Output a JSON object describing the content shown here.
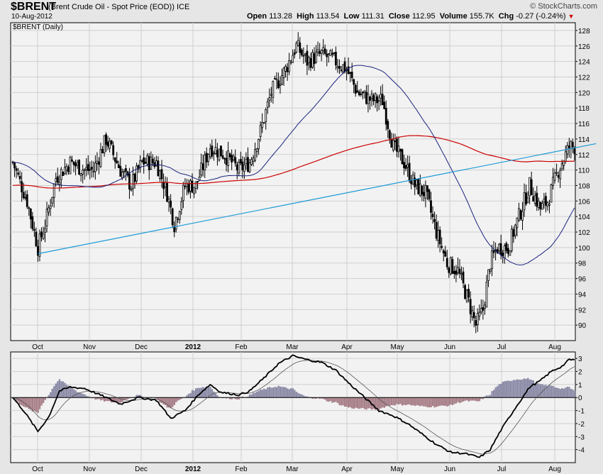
{
  "header": {
    "symbol": "$BRENT",
    "description": "(Brent Crude Oil - Spot Price (EOD))",
    "exchange": "ICE",
    "date": "10-Aug-2012",
    "logo": "© StockCharts.com",
    "open_label": "Open",
    "open": "113.28",
    "high_label": "High",
    "high": "113.54",
    "low_label": "Low",
    "low": "111.31",
    "close_label": "Close",
    "close": "112.95",
    "volume_label": "Volume",
    "volume": "155.7K",
    "chg_label": "Chg",
    "chg": "-0.27 (-0.24%)",
    "chg_icon": "down-triangle-icon"
  },
  "chart_data": [
    {
      "type": "candlestick",
      "legend_label": "$BRENT (Daily)",
      "ylim": [
        88,
        129
      ],
      "y_ticks": [
        90,
        92,
        94,
        96,
        98,
        100,
        102,
        104,
        106,
        108,
        110,
        112,
        114,
        116,
        118,
        120,
        122,
        124,
        126,
        128
      ],
      "x_ticks": [
        "Oct",
        "Nov",
        "Dec",
        "2012",
        "Feb",
        "Mar",
        "Apr",
        "May",
        "Jun",
        "Jul",
        "Aug"
      ],
      "grid": true,
      "price_keypoints": [
        [
          0,
          111
        ],
        [
          8,
          106
        ],
        [
          14,
          100
        ],
        [
          18,
          103
        ],
        [
          24,
          109
        ],
        [
          32,
          111
        ],
        [
          40,
          110
        ],
        [
          45,
          110
        ],
        [
          52,
          114
        ],
        [
          60,
          110
        ],
        [
          66,
          108
        ],
        [
          72,
          111
        ],
        [
          80,
          111
        ],
        [
          86,
          107
        ],
        [
          90,
          103
        ],
        [
          96,
          108
        ],
        [
          102,
          108
        ],
        [
          110,
          113
        ],
        [
          118,
          112
        ],
        [
          126,
          110
        ],
        [
          132,
          111
        ],
        [
          138,
          115
        ],
        [
          144,
          120
        ],
        [
          152,
          123
        ],
        [
          158,
          126
        ],
        [
          164,
          124
        ],
        [
          172,
          125
        ],
        [
          180,
          124
        ],
        [
          186,
          123
        ],
        [
          192,
          120
        ],
        [
          200,
          119
        ],
        [
          206,
          119
        ],
        [
          212,
          113
        ],
        [
          218,
          111
        ],
        [
          224,
          108
        ],
        [
          230,
          107
        ],
        [
          236,
          102
        ],
        [
          242,
          98
        ],
        [
          248,
          97
        ],
        [
          254,
          93
        ],
        [
          258,
          90
        ],
        [
          262,
          92
        ],
        [
          266,
          98
        ],
        [
          270,
          100
        ],
        [
          276,
          100
        ],
        [
          282,
          104
        ],
        [
          288,
          108
        ],
        [
          294,
          105
        ],
        [
          298,
          106
        ],
        [
          304,
          110
        ],
        [
          308,
          112
        ],
        [
          310,
          113
        ]
      ],
      "overlays": [
        {
          "name": "ma50",
          "color": "#1a237e"
        },
        {
          "name": "ma200",
          "color": "#cc0000"
        },
        {
          "name": "trendline",
          "color": "#1a9ad6",
          "from": [
            14,
            99.2
          ],
          "to": [
            325,
            113.4
          ]
        }
      ]
    },
    {
      "type": "oscillator",
      "ylim": [
        -5,
        3.5
      ],
      "y_ticks": [
        -4,
        -3,
        -2,
        -1,
        0,
        1,
        2,
        3
      ],
      "x_ticks": [
        "Oct",
        "Nov",
        "Dec",
        "2012",
        "Feb",
        "Mar",
        "Apr",
        "May",
        "Jun",
        "Jul",
        "Aug"
      ],
      "grid": true,
      "macd_keypoints": [
        [
          0,
          0
        ],
        [
          6,
          -1
        ],
        [
          14,
          -2.6
        ],
        [
          20,
          -1.5
        ],
        [
          26,
          0.5
        ],
        [
          32,
          0.8
        ],
        [
          40,
          0.7
        ],
        [
          52,
          0
        ],
        [
          60,
          -0.5
        ],
        [
          70,
          0
        ],
        [
          80,
          -0.2
        ],
        [
          88,
          -1.6
        ],
        [
          96,
          -1
        ],
        [
          104,
          0.3
        ],
        [
          110,
          1
        ],
        [
          116,
          0.4
        ],
        [
          126,
          0.2
        ],
        [
          132,
          0.5
        ],
        [
          140,
          1.5
        ],
        [
          148,
          2.6
        ],
        [
          156,
          3.2
        ],
        [
          164,
          2.9
        ],
        [
          172,
          2.7
        ],
        [
          180,
          2.1
        ],
        [
          188,
          1
        ],
        [
          196,
          0
        ],
        [
          204,
          -1
        ],
        [
          212,
          -1.4
        ],
        [
          220,
          -2
        ],
        [
          228,
          -2.8
        ],
        [
          236,
          -3.6
        ],
        [
          244,
          -4.2
        ],
        [
          252,
          -4.3
        ],
        [
          260,
          -4.6
        ],
        [
          266,
          -4
        ],
        [
          272,
          -2.5
        ],
        [
          280,
          -0.8
        ],
        [
          288,
          0.8
        ],
        [
          294,
          1.3
        ],
        [
          300,
          2
        ],
        [
          306,
          2.4
        ],
        [
          310,
          2.9
        ]
      ],
      "series": [
        {
          "name": "macd",
          "color": "#000000"
        },
        {
          "name": "signal",
          "color": "#555555"
        },
        {
          "name": "histogram",
          "positive_color": "#8c8ca8",
          "negative_color": "#a8808a"
        }
      ]
    }
  ]
}
